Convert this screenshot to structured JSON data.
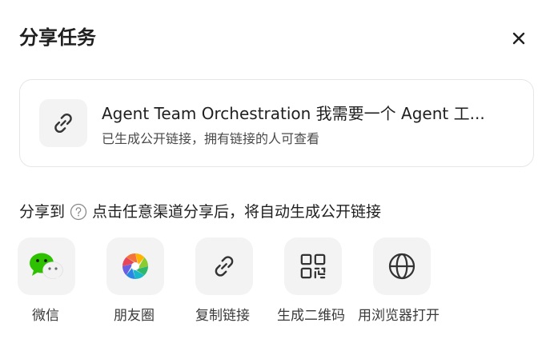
{
  "dialog": {
    "title": "分享任务",
    "close_icon": "close-icon"
  },
  "card": {
    "icon": "link-icon",
    "title": "Agent Team Orchestration 我需要一个 Agent 工...",
    "subtitle": "已生成公开链接，拥有链接的人可查看"
  },
  "share": {
    "label": "分享到",
    "help_icon": "question-circle-icon",
    "hint": "点击任意渠道分享后，将自动生成公开链接",
    "options": [
      {
        "label": "微信",
        "icon": "wechat-icon"
      },
      {
        "label": "朋友圈",
        "icon": "moments-icon"
      },
      {
        "label": "复制链接",
        "icon": "link-icon"
      },
      {
        "label": "生成二维码",
        "icon": "qr-code-icon"
      },
      {
        "label": "用浏览器打开",
        "icon": "globe-icon"
      }
    ]
  },
  "colors": {
    "wechat_green": "#2dc100",
    "card_border": "#e6e6e6",
    "tile_bg": "#f3f3f3"
  }
}
